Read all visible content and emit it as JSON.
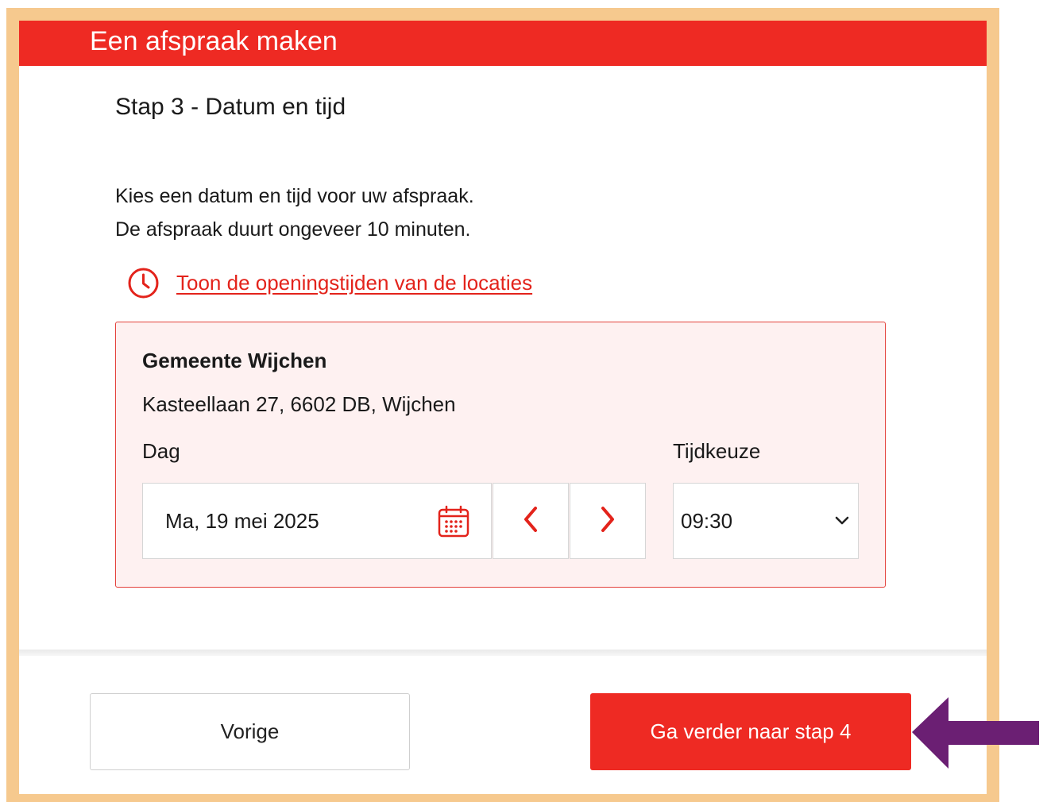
{
  "header": {
    "title": "Een afspraak maken"
  },
  "step": {
    "title": "Stap 3 - Datum en tijd"
  },
  "intro": {
    "line1": "Kies een datum en tijd voor uw afspraak.",
    "line2": "De afspraak duurt ongeveer 10 minuten."
  },
  "opening_hours": {
    "icon": "clock-icon",
    "link_text": "Toon de openingstijden van de locaties"
  },
  "location": {
    "name": "Gemeente Wijchen",
    "address": "Kasteellaan 27, 6602 DB, Wijchen",
    "day_label": "Dag",
    "time_label": "Tijdkeuze",
    "date_value": "Ma, 19 mei 2025",
    "time_value": "09:30",
    "icons": {
      "calendar": "calendar-icon",
      "prev": "chevron-left-icon",
      "next": "chevron-right-icon",
      "dropdown": "chevron-down-icon"
    }
  },
  "footer": {
    "back_label": "Vorige",
    "next_label": "Ga verder naar stap 4"
  },
  "annotation": {
    "icon": "arrow-left-icon",
    "color": "#6b1f73"
  },
  "colors": {
    "brand_red": "#ee2a23",
    "frame": "#f6c98e",
    "box_bg": "#fef1f1",
    "box_border": "#e4413b"
  }
}
